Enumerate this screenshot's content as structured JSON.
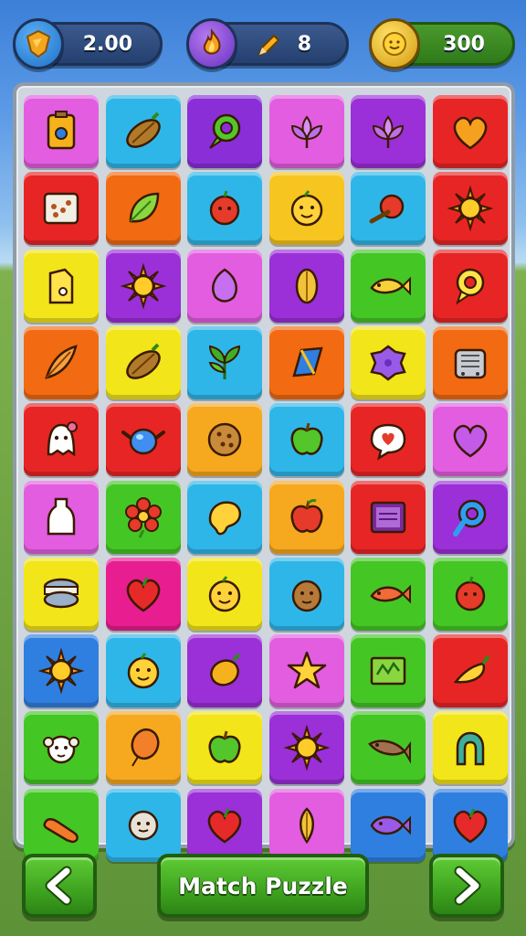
{
  "hud": {
    "lives": {
      "value": "2.00",
      "icon": "heart-crest-icon",
      "color": "#f3a620"
    },
    "moves": {
      "value": "8",
      "icon": "pencil-icon",
      "color": "#8e4fd8"
    },
    "coins": {
      "value": "300",
      "icon": "coin-icon",
      "color": "#f2c12e"
    }
  },
  "board": {
    "columns": 6,
    "rows": 10,
    "tiles": [
      {
        "color": "#e35de0",
        "icon": "potion-jar"
      },
      {
        "color": "#2fb6e8",
        "icon": "cocoa-pod"
      },
      {
        "color": "#8a2fd8",
        "icon": "green-ring"
      },
      {
        "color": "#e35de0",
        "icon": "lotus-flower"
      },
      {
        "color": "#9b2fd8",
        "icon": "lotus-flower"
      },
      {
        "color": "#e82525",
        "icon": "orange-heart"
      },
      {
        "color": "#e82525",
        "icon": "seed-box"
      },
      {
        "color": "#f26a12",
        "icon": "green-leaf"
      },
      {
        "color": "#2fb6e8",
        "icon": "red-fruit"
      },
      {
        "color": "#f6c51f",
        "icon": "yellow-face"
      },
      {
        "color": "#2fb6e8",
        "icon": "apple-branch"
      },
      {
        "color": "#e82525",
        "icon": "sun"
      },
      {
        "color": "#f2e51a",
        "icon": "milk-carton"
      },
      {
        "color": "#9b2fd8",
        "icon": "sun"
      },
      {
        "color": "#e35de0",
        "icon": "purple-gem"
      },
      {
        "color": "#9b2fd8",
        "icon": "golden-leaf"
      },
      {
        "color": "#44c625",
        "icon": "yellow-fish"
      },
      {
        "color": "#e82525",
        "icon": "yellow-ring"
      },
      {
        "color": "#f26a12",
        "icon": "wheat-leaf"
      },
      {
        "color": "#f2e51a",
        "icon": "cocoa-pod"
      },
      {
        "color": "#2fb6e8",
        "icon": "green-herb"
      },
      {
        "color": "#f26a12",
        "icon": "blue-diamond"
      },
      {
        "color": "#f2e51a",
        "icon": "purple-blob"
      },
      {
        "color": "#f26a12",
        "icon": "toaster"
      },
      {
        "color": "#e82525",
        "icon": "white-ghost"
      },
      {
        "color": "#e82525",
        "icon": "blue-teapot"
      },
      {
        "color": "#f6a81f",
        "icon": "cookie"
      },
      {
        "color": "#2fb6e8",
        "icon": "green-apple"
      },
      {
        "color": "#e82525",
        "icon": "speech-heart"
      },
      {
        "color": "#e35de0",
        "icon": "purple-heart"
      },
      {
        "color": "#e35de0",
        "icon": "milk-bottle"
      },
      {
        "color": "#44c625",
        "icon": "red-flower"
      },
      {
        "color": "#2fb6e8",
        "icon": "yellow-blob"
      },
      {
        "color": "#f6a81f",
        "icon": "red-apple"
      },
      {
        "color": "#e82525",
        "icon": "purple-box"
      },
      {
        "color": "#9b2fd8",
        "icon": "blue-ring"
      },
      {
        "color": "#f2e51a",
        "icon": "macaron"
      },
      {
        "color": "#e81d8f",
        "icon": "red-heart"
      },
      {
        "color": "#f2e51a",
        "icon": "yellow-face"
      },
      {
        "color": "#2fb6e8",
        "icon": "brown-face"
      },
      {
        "color": "#44c625",
        "icon": "red-fish"
      },
      {
        "color": "#44c625",
        "icon": "red-fruit"
      },
      {
        "color": "#2f7fe0",
        "icon": "sun"
      },
      {
        "color": "#2fb6e8",
        "icon": "yellow-face"
      },
      {
        "color": "#9b2fd8",
        "icon": "mango"
      },
      {
        "color": "#e35de0",
        "icon": "yellow-star"
      },
      {
        "color": "#44c625",
        "icon": "ticket"
      },
      {
        "color": "#e82525",
        "icon": "yellow-pepper"
      },
      {
        "color": "#44c625",
        "icon": "white-face"
      },
      {
        "color": "#f6a81f",
        "icon": "orange-balloon"
      },
      {
        "color": "#f2e51a",
        "icon": "green-apple"
      },
      {
        "color": "#9b2fd8",
        "icon": "sun"
      },
      {
        "color": "#44c625",
        "icon": "brown-fish"
      },
      {
        "color": "#f2e51a",
        "icon": "green-horseshoe"
      },
      {
        "color": "#44c625",
        "icon": "sausage"
      },
      {
        "color": "#2fb6e8",
        "icon": "grey-face"
      },
      {
        "color": "#9b2fd8",
        "icon": "red-heart"
      },
      {
        "color": "#e35de0",
        "icon": "golden-corn"
      },
      {
        "color": "#2f7fe0",
        "icon": "purple-fish"
      },
      {
        "color": "#2f7fe0",
        "icon": "red-heart"
      }
    ]
  },
  "footer": {
    "back_icon": "chevron-left-icon",
    "title": "Match Puzzle",
    "next_icon": "chevron-right-icon"
  }
}
